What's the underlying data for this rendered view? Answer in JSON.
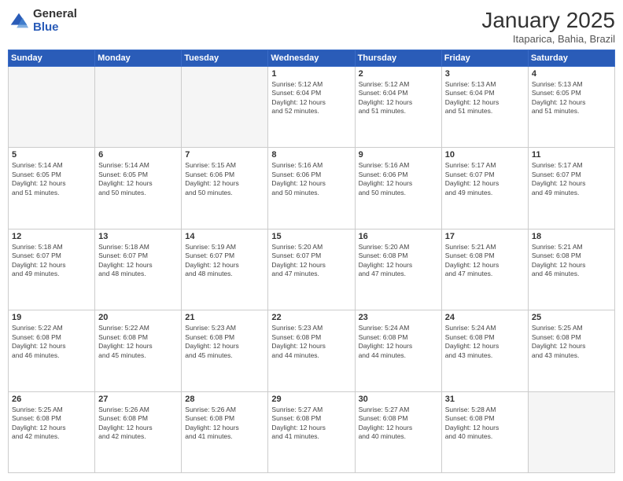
{
  "logo": {
    "general": "General",
    "blue": "Blue"
  },
  "header": {
    "month": "January 2025",
    "location": "Itaparica, Bahia, Brazil"
  },
  "weekdays": [
    "Sunday",
    "Monday",
    "Tuesday",
    "Wednesday",
    "Thursday",
    "Friday",
    "Saturday"
  ],
  "weeks": [
    [
      {
        "day": "",
        "info": ""
      },
      {
        "day": "",
        "info": ""
      },
      {
        "day": "",
        "info": ""
      },
      {
        "day": "1",
        "info": "Sunrise: 5:12 AM\nSunset: 6:04 PM\nDaylight: 12 hours\nand 52 minutes."
      },
      {
        "day": "2",
        "info": "Sunrise: 5:12 AM\nSunset: 6:04 PM\nDaylight: 12 hours\nand 51 minutes."
      },
      {
        "day": "3",
        "info": "Sunrise: 5:13 AM\nSunset: 6:04 PM\nDaylight: 12 hours\nand 51 minutes."
      },
      {
        "day": "4",
        "info": "Sunrise: 5:13 AM\nSunset: 6:05 PM\nDaylight: 12 hours\nand 51 minutes."
      }
    ],
    [
      {
        "day": "5",
        "info": "Sunrise: 5:14 AM\nSunset: 6:05 PM\nDaylight: 12 hours\nand 51 minutes."
      },
      {
        "day": "6",
        "info": "Sunrise: 5:14 AM\nSunset: 6:05 PM\nDaylight: 12 hours\nand 50 minutes."
      },
      {
        "day": "7",
        "info": "Sunrise: 5:15 AM\nSunset: 6:06 PM\nDaylight: 12 hours\nand 50 minutes."
      },
      {
        "day": "8",
        "info": "Sunrise: 5:16 AM\nSunset: 6:06 PM\nDaylight: 12 hours\nand 50 minutes."
      },
      {
        "day": "9",
        "info": "Sunrise: 5:16 AM\nSunset: 6:06 PM\nDaylight: 12 hours\nand 50 minutes."
      },
      {
        "day": "10",
        "info": "Sunrise: 5:17 AM\nSunset: 6:07 PM\nDaylight: 12 hours\nand 49 minutes."
      },
      {
        "day": "11",
        "info": "Sunrise: 5:17 AM\nSunset: 6:07 PM\nDaylight: 12 hours\nand 49 minutes."
      }
    ],
    [
      {
        "day": "12",
        "info": "Sunrise: 5:18 AM\nSunset: 6:07 PM\nDaylight: 12 hours\nand 49 minutes."
      },
      {
        "day": "13",
        "info": "Sunrise: 5:18 AM\nSunset: 6:07 PM\nDaylight: 12 hours\nand 48 minutes."
      },
      {
        "day": "14",
        "info": "Sunrise: 5:19 AM\nSunset: 6:07 PM\nDaylight: 12 hours\nand 48 minutes."
      },
      {
        "day": "15",
        "info": "Sunrise: 5:20 AM\nSunset: 6:07 PM\nDaylight: 12 hours\nand 47 minutes."
      },
      {
        "day": "16",
        "info": "Sunrise: 5:20 AM\nSunset: 6:08 PM\nDaylight: 12 hours\nand 47 minutes."
      },
      {
        "day": "17",
        "info": "Sunrise: 5:21 AM\nSunset: 6:08 PM\nDaylight: 12 hours\nand 47 minutes."
      },
      {
        "day": "18",
        "info": "Sunrise: 5:21 AM\nSunset: 6:08 PM\nDaylight: 12 hours\nand 46 minutes."
      }
    ],
    [
      {
        "day": "19",
        "info": "Sunrise: 5:22 AM\nSunset: 6:08 PM\nDaylight: 12 hours\nand 46 minutes."
      },
      {
        "day": "20",
        "info": "Sunrise: 5:22 AM\nSunset: 6:08 PM\nDaylight: 12 hours\nand 45 minutes."
      },
      {
        "day": "21",
        "info": "Sunrise: 5:23 AM\nSunset: 6:08 PM\nDaylight: 12 hours\nand 45 minutes."
      },
      {
        "day": "22",
        "info": "Sunrise: 5:23 AM\nSunset: 6:08 PM\nDaylight: 12 hours\nand 44 minutes."
      },
      {
        "day": "23",
        "info": "Sunrise: 5:24 AM\nSunset: 6:08 PM\nDaylight: 12 hours\nand 44 minutes."
      },
      {
        "day": "24",
        "info": "Sunrise: 5:24 AM\nSunset: 6:08 PM\nDaylight: 12 hours\nand 43 minutes."
      },
      {
        "day": "25",
        "info": "Sunrise: 5:25 AM\nSunset: 6:08 PM\nDaylight: 12 hours\nand 43 minutes."
      }
    ],
    [
      {
        "day": "26",
        "info": "Sunrise: 5:25 AM\nSunset: 6:08 PM\nDaylight: 12 hours\nand 42 minutes."
      },
      {
        "day": "27",
        "info": "Sunrise: 5:26 AM\nSunset: 6:08 PM\nDaylight: 12 hours\nand 42 minutes."
      },
      {
        "day": "28",
        "info": "Sunrise: 5:26 AM\nSunset: 6:08 PM\nDaylight: 12 hours\nand 41 minutes."
      },
      {
        "day": "29",
        "info": "Sunrise: 5:27 AM\nSunset: 6:08 PM\nDaylight: 12 hours\nand 41 minutes."
      },
      {
        "day": "30",
        "info": "Sunrise: 5:27 AM\nSunset: 6:08 PM\nDaylight: 12 hours\nand 40 minutes."
      },
      {
        "day": "31",
        "info": "Sunrise: 5:28 AM\nSunset: 6:08 PM\nDaylight: 12 hours\nand 40 minutes."
      },
      {
        "day": "",
        "info": ""
      }
    ]
  ]
}
